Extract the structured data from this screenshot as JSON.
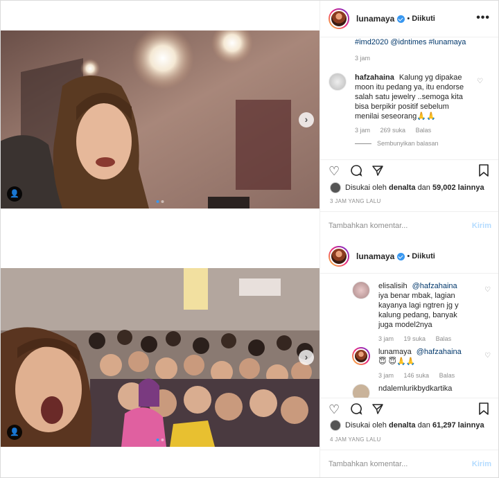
{
  "post1": {
    "header": {
      "username": "lunamaya",
      "separator": "•",
      "follow_label": "Diikuti",
      "more": "•••"
    },
    "caption_tags": "#imd2020 @idntimes #lunamaya",
    "caption_time": "3 jam",
    "comments": [
      {
        "user": "hafzahaina",
        "text": "Kalung yg dipakae moon itu pedang ya, itu endorse salah satu jewelry ..semoga kita bisa berpikir positif sebelum menilai seseorang🙏🙏",
        "time": "3 jam",
        "likes": "269 suka",
        "reply": "Balas"
      }
    ],
    "hide_replies": "Sembunyikan balasan",
    "likes_prefix": "Disukai oleh",
    "likes_user": "denalta",
    "likes_mid": "dan",
    "likes_count": "59,002 lainnya",
    "posted_time": "3 JAM YANG LALU",
    "add_comment_placeholder": "Tambahkan komentar...",
    "send_label": "Kirim",
    "carousel_next": "›",
    "user_tag_icon": "👤"
  },
  "post2": {
    "header": {
      "username": "lunamaya",
      "separator": "•",
      "follow_label": "Diikuti"
    },
    "comments": [
      {
        "user": "elisalisih",
        "mention": "@hafzahaina",
        "text": "iya benar mbak, lagian kayanya lagi ngtren jg y kalung pedang, banyak juga model2nya",
        "time": "3 jam",
        "likes": "19 suka",
        "reply": "Balas"
      },
      {
        "user": "lunamaya",
        "mention": "@hafzahaina",
        "text": "😇 😇🙏🙏",
        "time": "3 jam",
        "likes": "146 suka",
        "reply": "Balas"
      },
      {
        "user": "ndalemlurikbydkartika",
        "text": ""
      }
    ],
    "likes_prefix": "Disukai oleh",
    "likes_user": "denalta",
    "likes_mid": "dan",
    "likes_count": "61,297 lainnya",
    "posted_time": "4 JAM YANG LALU",
    "add_comment_placeholder": "Tambahkan komentar...",
    "send_label": "Kirim",
    "carousel_next": "›",
    "user_tag_icon": "👤"
  },
  "colors": {
    "link": "#00376b",
    "verified": "#3897f0",
    "muted": "#8e8e8e",
    "send_disabled": "#b3dbff"
  },
  "icons": [
    "verified-badge-icon",
    "heart-icon",
    "comment-icon",
    "share-icon",
    "bookmark-icon",
    "more-options-icon",
    "carousel-next-icon",
    "user-tag-icon"
  ]
}
